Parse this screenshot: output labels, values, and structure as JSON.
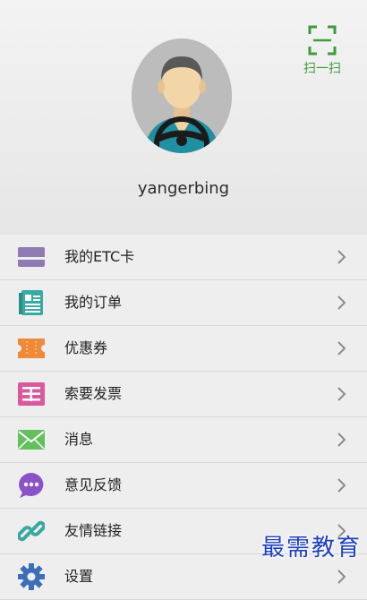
{
  "profile": {
    "username": "yangerbing"
  },
  "scan": {
    "label": "扫一扫"
  },
  "menu": {
    "items": [
      {
        "label": "我的ETC卡",
        "icon": "etc-card-icon",
        "color": "#8d7bb2"
      },
      {
        "label": "我的订单",
        "icon": "order-icon",
        "color": "#38a9a3"
      },
      {
        "label": "优惠券",
        "icon": "coupon-icon",
        "color": "#ee8a3a"
      },
      {
        "label": "索要发票",
        "icon": "invoice-icon",
        "color": "#d95a9c"
      },
      {
        "label": "消息",
        "icon": "message-icon",
        "color": "#65bf5e"
      },
      {
        "label": "意见反馈",
        "icon": "feedback-icon",
        "color": "#8a52c6"
      },
      {
        "label": "友情链接",
        "icon": "link-icon",
        "color": "#3aa89f"
      },
      {
        "label": "设置",
        "icon": "settings-icon",
        "color": "#3d6fb8"
      }
    ]
  },
  "watermark": "最需教育",
  "colors": {
    "accent_green": "#3c9c3c",
    "background": "#eeeeee"
  }
}
